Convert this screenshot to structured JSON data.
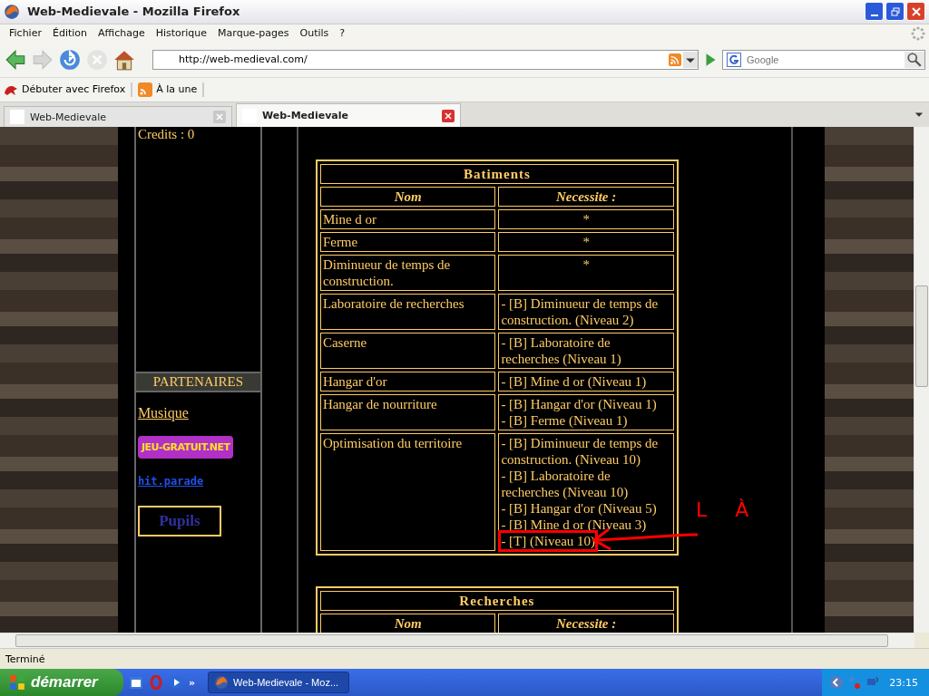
{
  "window": {
    "title": "Web-Medievale - Mozilla Firefox"
  },
  "menu": [
    "Fichier",
    "Édition",
    "Affichage",
    "Historique",
    "Marque-pages",
    "Outils",
    "?"
  ],
  "nav": {
    "url": "http://web-medieval.com/",
    "search_placeholder": "Google"
  },
  "bookmarks": [
    "Débuter avec Firefox",
    "À la une"
  ],
  "tabs": [
    {
      "label": "Web-Medievale",
      "selected": false
    },
    {
      "label": "Web-Medievale",
      "selected": true
    }
  ],
  "sidebar": {
    "credits": "Credits : 0",
    "heading": "PARTENAIRES",
    "links": [
      {
        "kind": "text",
        "label": "Musique"
      },
      {
        "kind": "banner",
        "label": "JEU-GRATUIT.NET"
      },
      {
        "kind": "pixel",
        "label": "hit.parade"
      },
      {
        "kind": "framed",
        "label": "Pupils"
      }
    ]
  },
  "tables": [
    {
      "title": "Batiments",
      "columns": [
        "Nom",
        "Necessite :"
      ],
      "rows": [
        {
          "name": "Mine d or",
          "kind": "base",
          "requirements": [
            {
              "text": "*",
              "highlighted": false
            }
          ]
        },
        {
          "name": "Ferme",
          "kind": "base",
          "requirements": [
            {
              "text": "*",
              "highlighted": false
            }
          ]
        },
        {
          "name": "Diminueur de temps de construction.",
          "kind": "base",
          "requirements": [
            {
              "text": "*",
              "highlighted": false
            }
          ]
        },
        {
          "name": "Laboratoire de recherches",
          "kind": "requires",
          "requirements": [
            {
              "text": "- [B] Diminueur de temps de construction. (Niveau 2)",
              "highlighted": false
            }
          ]
        },
        {
          "name": "Caserne",
          "kind": "requires",
          "requirements": [
            {
              "text": "- [B] Laboratoire de recherches (Niveau 1)",
              "highlighted": false
            }
          ]
        },
        {
          "name": "Hangar d'or",
          "kind": "requires",
          "requirements": [
            {
              "text": "- [B] Mine d or (Niveau 1)",
              "highlighted": false
            }
          ]
        },
        {
          "name": "Hangar de nourriture",
          "kind": "requires",
          "requirements": [
            {
              "text": "- [B] Hangar d'or (Niveau 1)",
              "highlighted": false
            },
            {
              "text": "- [B] Ferme (Niveau 1)",
              "highlighted": false
            }
          ]
        },
        {
          "name": "Optimisation du territoire",
          "kind": "requires",
          "requirements": [
            {
              "text": "- [B] Diminueur de temps de construction. (Niveau 10)",
              "highlighted": false
            },
            {
              "text": "- [B] Laboratoire de recherches (Niveau 10)",
              "highlighted": false
            },
            {
              "text": "- [B] Hangar d'or (Niveau 5)",
              "highlighted": false
            },
            {
              "text": "- [B] Mine d or (Niveau 3)",
              "highlighted": false
            },
            {
              "text": "- [T] (Niveau 10)",
              "highlighted": true
            }
          ]
        }
      ]
    },
    {
      "title": "Recherches",
      "columns": [
        "Nom",
        "Necessite :"
      ]
    }
  ],
  "annotation": {
    "text": "L À"
  },
  "status_bar": "Terminé",
  "taskbar": {
    "start": "démarrer",
    "more": "»",
    "task": "Web-Medievale - Moz...",
    "clock": "23:15"
  }
}
